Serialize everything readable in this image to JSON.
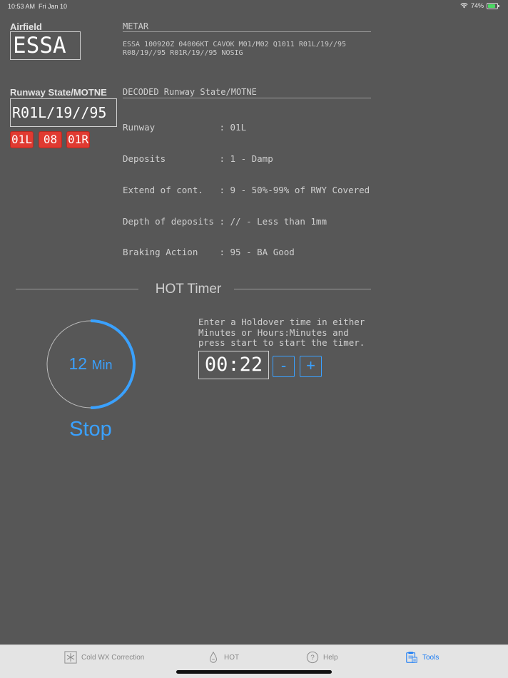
{
  "status_bar": {
    "time": "10:53 AM",
    "date": "Fri Jan 10",
    "battery": "74%"
  },
  "airfield": {
    "label": "Airfield",
    "value": "ESSA"
  },
  "metar": {
    "label": "METAR",
    "text": "ESSA 100920Z 04006KT CAVOK M01/M02 Q1011 R01L/19//95 R08/19//95 R01R/19//95 NOSIG"
  },
  "runway_state": {
    "label": "Runway State/MOTNE",
    "value": "R01L/19//95",
    "runways": [
      "01L",
      "08",
      "01R"
    ]
  },
  "decoded": {
    "label": "DECODED Runway State/MOTNE",
    "rows": [
      {
        "key": "Runway           ",
        "value": ": 01L"
      },
      {
        "key": "Deposits         ",
        "value": ": 1 - Damp"
      },
      {
        "key": "Extend of cont.  ",
        "value": ": 9 - 50%-99% of RWY Covered"
      },
      {
        "key": "Depth of deposits",
        "value": ": // - Less than 1mm"
      },
      {
        "key": "Braking Action   ",
        "value": ": 95 - BA Good"
      }
    ]
  },
  "hot_timer": {
    "title": "HOT Timer",
    "remaining_value": "12",
    "remaining_unit": "Min",
    "progress": 0.5,
    "stop_label": "Stop",
    "instructions": "Enter a Holdover time in either Minutes or Hours:Minutes and press start to start the timer.",
    "time_value": "00:22",
    "minus_label": "-",
    "plus_label": "+"
  },
  "colors": {
    "accent": "#3aa1ff",
    "runway_button": "#e03a31",
    "background": "#575757"
  },
  "tabs": [
    {
      "label": "Cold WX Correction",
      "icon": "snowflake-icon",
      "active": false
    },
    {
      "label": "HOT",
      "icon": "droplet-icon",
      "active": false
    },
    {
      "label": "Help",
      "icon": "help-icon",
      "active": false
    },
    {
      "label": "Tools",
      "icon": "tools-icon",
      "active": true
    }
  ]
}
